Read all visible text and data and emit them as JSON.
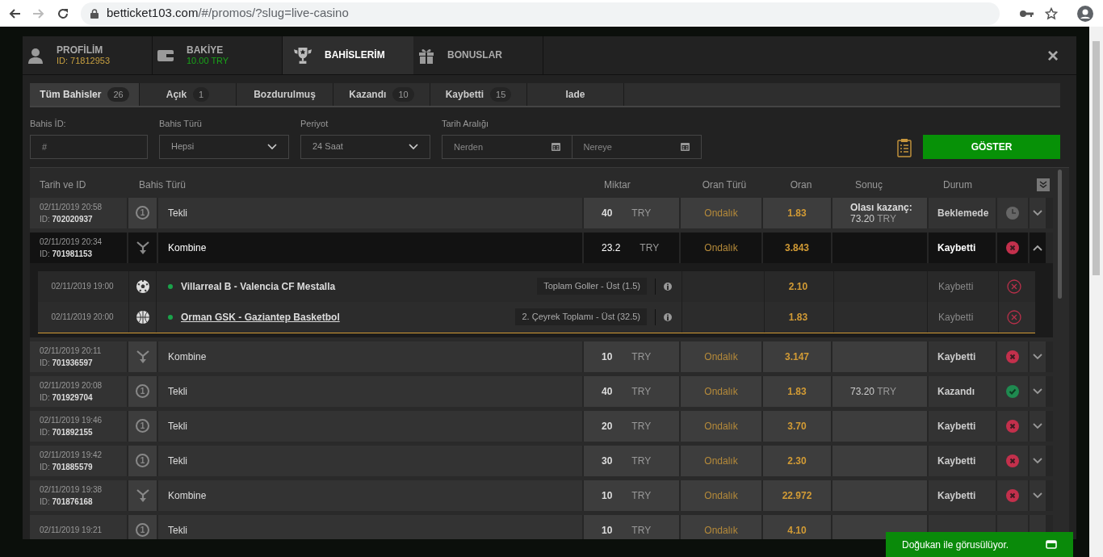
{
  "browser": {
    "host": "betticket103.com",
    "path": "/#/promos/?slug=live-casino",
    "forward_disabled": true
  },
  "top_tabs": [
    {
      "kind": "profile",
      "label": "PROFİLİM",
      "sub": {
        "kind": "id",
        "text": "ID: 71812953"
      },
      "selected": false
    },
    {
      "kind": "wallet",
      "label": "BAKİYE",
      "sub": {
        "kind": "money",
        "text": "10.00 TRY"
      },
      "selected": false
    },
    {
      "kind": "trophy",
      "label": "BAHİSLERİM",
      "selected": true
    },
    {
      "kind": "gift",
      "label": "BONUSLAR",
      "selected": false
    }
  ],
  "close": "×",
  "filter_tabs": [
    {
      "label": "Tüm Bahisler",
      "count": "26",
      "selected": true
    },
    {
      "label": "Açık",
      "count": "1",
      "selected": false
    },
    {
      "label": "Bozdurulmuş",
      "selected": false
    },
    {
      "label": "Kazandı",
      "count": "10",
      "selected": false
    },
    {
      "label": "Kaybetti",
      "count": "15",
      "selected": false
    },
    {
      "label": "Iade",
      "selected": false
    }
  ],
  "filters": {
    "bet_id": {
      "label": "Bahis İD:",
      "placeholder": "#"
    },
    "bet_type": {
      "label": "Bahis Türü",
      "value": "Hepsi"
    },
    "period": {
      "label": "Periyot",
      "value": "24 Saat"
    },
    "date_range": {
      "label": "Tarih Aralığı",
      "from_placeholder": "Nerden",
      "to_placeholder": "Nereye"
    },
    "show_button": "GÖSTER"
  },
  "table": {
    "columns": [
      "Tarih ve ID",
      "Bahis Türü",
      "Miktar",
      "Oran Türü",
      "Oran",
      "Sonuç",
      "Durum"
    ],
    "rows": [
      {
        "date": "02/11/2019 20:58",
        "id_label": "ID:",
        "id": "702020937",
        "kind": "single",
        "badge": "1",
        "type": "Tekli",
        "amount": "40",
        "currency": "TRY",
        "odds_type": "Ondalık",
        "odds": "1.83",
        "result_label": "Olası kazanç:",
        "result": "73.20",
        "result_currency": "TRY",
        "status": "Beklemede",
        "status_icon": {
          "kind": "pending"
        },
        "expanded": false
      },
      {
        "date": "02/11/2019 20:34",
        "id_label": "ID:",
        "id": "701981153",
        "kind": "combo",
        "type": "Kombine",
        "amount": "23.2",
        "currency": "TRY",
        "odds_type": "Ondalık",
        "odds": "3.843",
        "status": "Kaybetti",
        "status_icon": {
          "kind": "lost"
        },
        "expanded": true,
        "selections": [
          {
            "date": "02/11/2019 19:00",
            "sport_icon": {
              "kind": "football"
            },
            "match": "Villarreal B - Valencia CF Mestalla",
            "underlined": false,
            "market": "Toplam Goller - Üst (1.5)",
            "odds": "2.10",
            "status": "Kaybetti",
            "status_icon": {
              "kind": "lost"
            }
          },
          {
            "date": "02/11/2019 20:00",
            "sport_icon": {
              "kind": "basketball"
            },
            "match": "Orman GSK - Gaziantep Basketbol",
            "underlined": true,
            "market": "2. Çeyrek Toplamı - Üst (32.5)",
            "odds": "1.83",
            "status": "Kaybetti",
            "status_icon": {
              "kind": "lost"
            }
          }
        ]
      },
      {
        "date": "02/11/2019 20:11",
        "id_label": "ID:",
        "id": "701936597",
        "kind": "combo",
        "type": "Kombine",
        "amount": "10",
        "currency": "TRY",
        "odds_type": "Ondalık",
        "odds": "3.147",
        "status": "Kaybetti",
        "status_icon": {
          "kind": "lost"
        },
        "expanded": false
      },
      {
        "date": "02/11/2019 20:08",
        "id_label": "ID:",
        "id": "701929704",
        "kind": "single",
        "badge": "1",
        "type": "Tekli",
        "amount": "40",
        "currency": "TRY",
        "odds_type": "Ondalık",
        "odds": "1.83",
        "result": "73.20",
        "result_currency": "TRY",
        "status": "Kazandı",
        "status_icon": {
          "kind": "won"
        },
        "expanded": false
      },
      {
        "date": "02/11/2019 19:46",
        "id_label": "ID:",
        "id": "701892155",
        "kind": "single",
        "badge": "1",
        "type": "Tekli",
        "amount": "20",
        "currency": "TRY",
        "odds_type": "Ondalık",
        "odds": "3.70",
        "status": "Kaybetti",
        "status_icon": {
          "kind": "lost"
        },
        "expanded": false
      },
      {
        "date": "02/11/2019 19:42",
        "id_label": "ID:",
        "id": "701885579",
        "kind": "single",
        "badge": "1",
        "type": "Tekli",
        "amount": "30",
        "currency": "TRY",
        "odds_type": "Ondalık",
        "odds": "2.30",
        "status": "Kaybetti",
        "status_icon": {
          "kind": "lost"
        },
        "expanded": false
      },
      {
        "date": "02/11/2019 19:38",
        "id_label": "ID:",
        "id": "701876168",
        "kind": "combo",
        "type": "Kombine",
        "amount": "10",
        "currency": "TRY",
        "odds_type": "Ondalık",
        "odds": "22.972",
        "status": "Kaybetti",
        "status_icon": {
          "kind": "lost"
        },
        "expanded": false
      },
      {
        "date": "02/11/2019 19:21",
        "kind": "single",
        "badge": "1",
        "type": "Tekli",
        "amount": "10",
        "currency": "TRY",
        "odds_type": "Ondalık",
        "odds": "4.10",
        "expanded": false
      }
    ]
  },
  "chat": {
    "label": "Doğukan ile görusülüyor."
  }
}
